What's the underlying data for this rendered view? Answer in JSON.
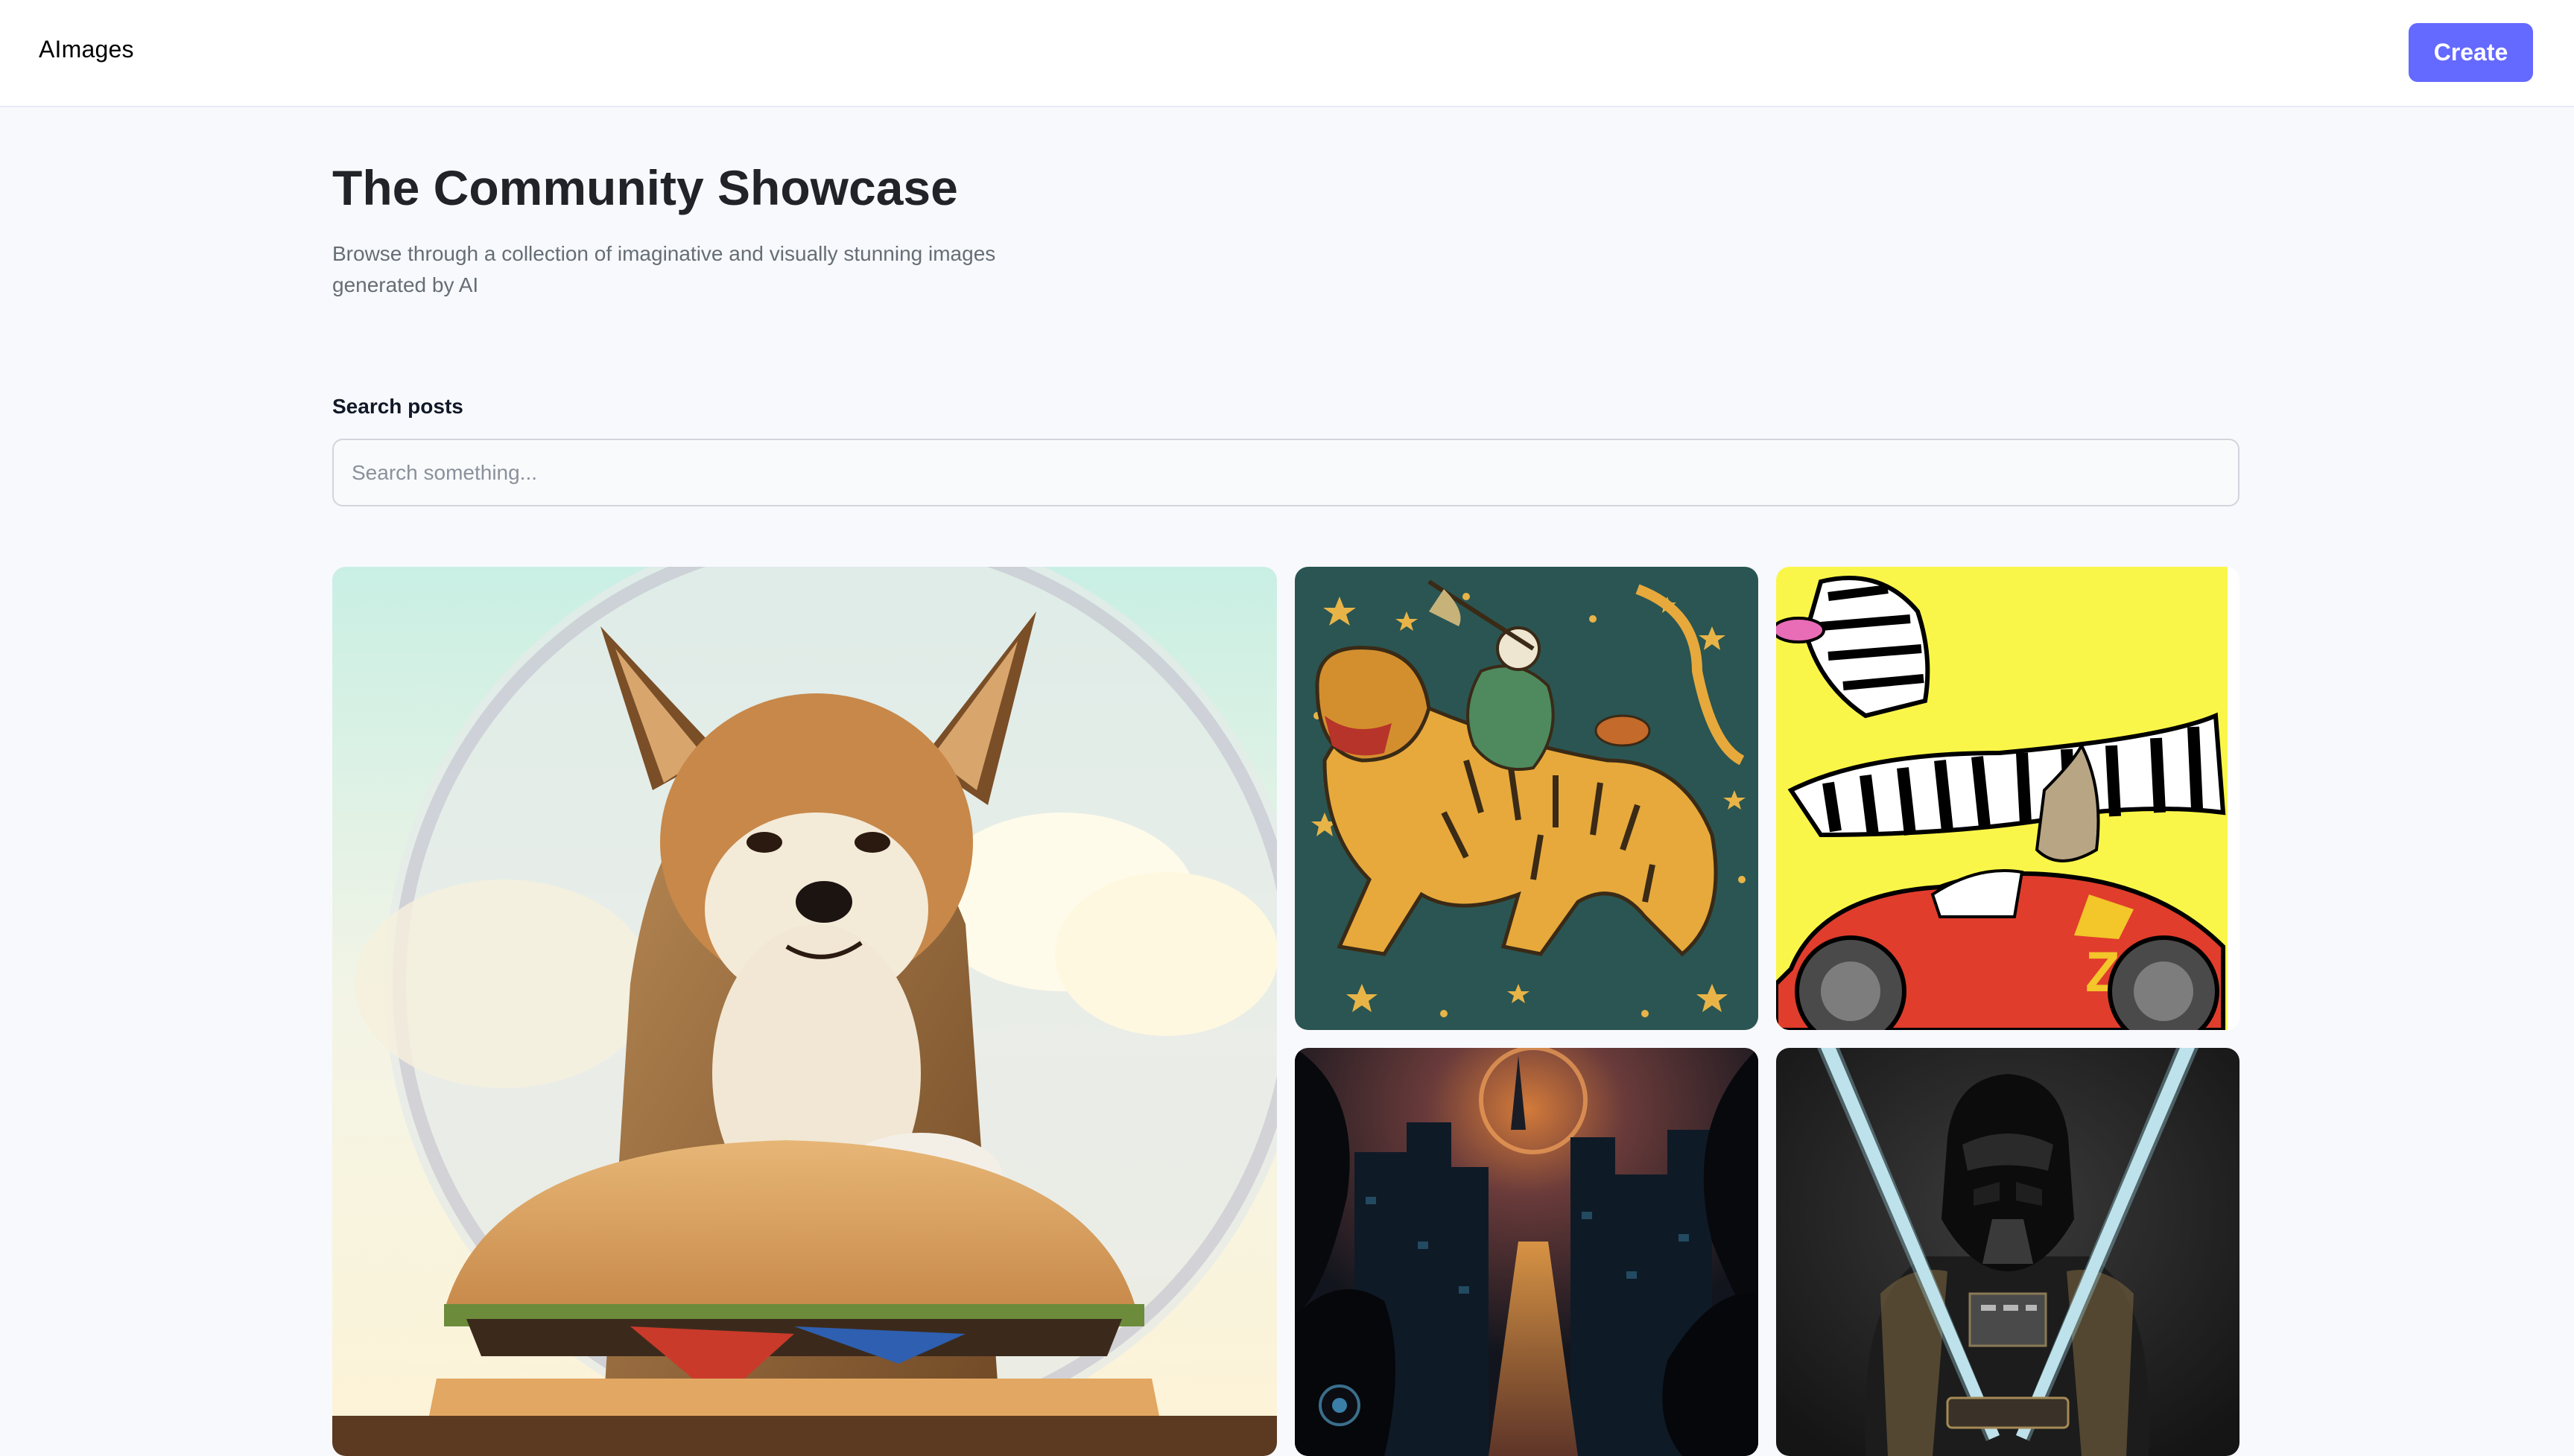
{
  "header": {
    "logo": "AImages",
    "create_label": "Create"
  },
  "main": {
    "title": "The Community Showcase",
    "subtitle": "Browse through a collection of imaginative and visually stunning images generated by AI"
  },
  "search": {
    "label": "Search posts",
    "placeholder": "Search something..."
  },
  "gallery": {
    "cards": [
      {
        "subject": "shiba inu in hood with burger"
      },
      {
        "subject": "lion and knight illustration"
      },
      {
        "subject": "zebra on red car"
      },
      {
        "subject": "dark sci-fi city"
      },
      {
        "subject": "darth vader with lightsabers"
      }
    ]
  },
  "colors": {
    "accent": "#6469ff",
    "page_bg": "#f8f9fd",
    "title": "#222328",
    "subtitle": "#666e75"
  }
}
